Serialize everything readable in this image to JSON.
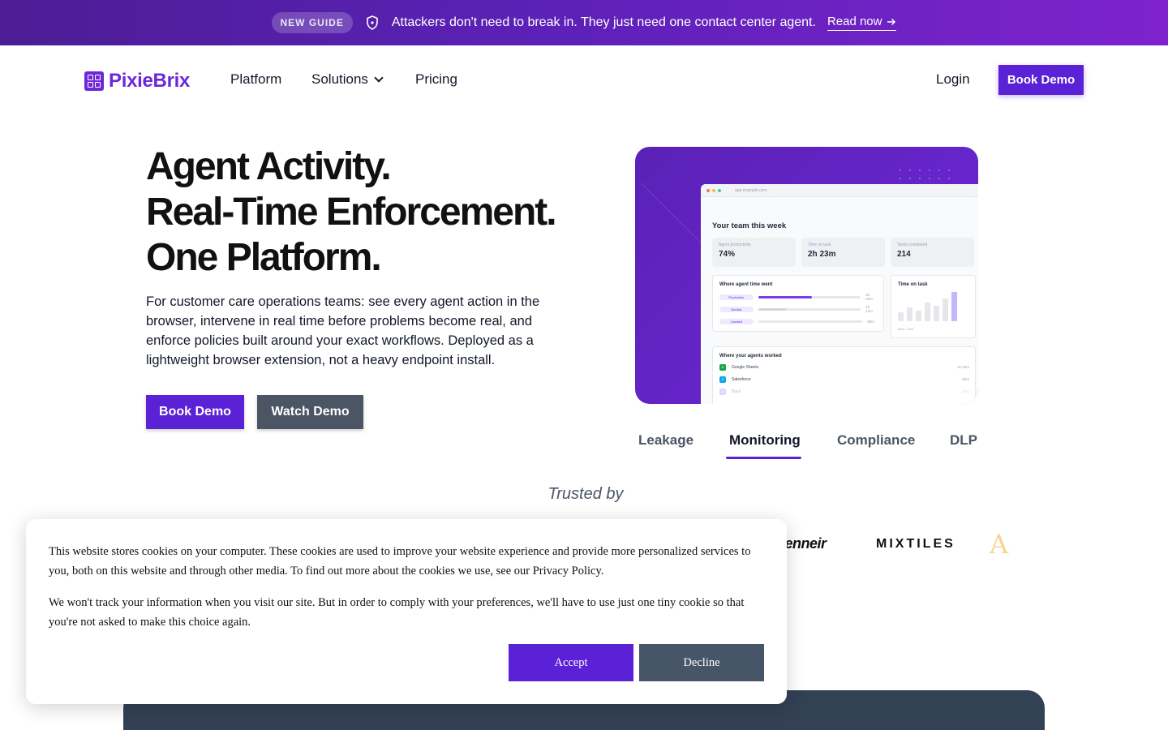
{
  "announcement": {
    "badge": "NEW GUIDE",
    "message": "Attackers don't need to break in. They just need one contact center agent.",
    "link": "Read now"
  },
  "nav": {
    "brand": "PixieBrix",
    "links": [
      "Platform",
      "Solutions",
      "Pricing"
    ],
    "login": "Login",
    "book_demo": "Book Demo"
  },
  "hero": {
    "title_lines": [
      "Agent Activity.",
      "Real-Time Enforcement.",
      "One Platform."
    ],
    "description": "For customer care operations teams: see every agent action in the browser, intervene in real time before problems become real, and enforce policies built around your exact workflows. Deployed as a lightweight browser extension, not a heavy endpoint install.",
    "book_demo": "Book Demo",
    "watch_demo": "Watch Demo"
  },
  "preview": {
    "url": "app.example.com",
    "heading": "Your team this week",
    "stats": [
      {
        "label": "Agent productivity",
        "value": "74%"
      },
      {
        "label": "Time on task",
        "value": "2h 23m"
      },
      {
        "label": "Tasks completed",
        "value": "214"
      }
    ],
    "time_panel": {
      "title": "Where agent time went",
      "rows": [
        {
          "label": "Productive",
          "time": "3h 05m",
          "fraction": 0.52,
          "color": "#7c3aed"
        },
        {
          "label": "Neutral",
          "time": "1h 12m",
          "fraction": 0.27,
          "color": "#d1d5db"
        },
        {
          "label": "Unrated",
          "time": "38m",
          "fraction": 0.15,
          "color": "#e5e7eb"
        }
      ]
    },
    "task_panel": {
      "title": "Time on task",
      "range": "Mon – Sun",
      "bars": [
        0.3,
        0.45,
        0.35,
        0.6,
        0.5,
        0.75,
        0.95
      ]
    },
    "sites_panel": {
      "title": "Where your agents worked",
      "rows": [
        {
          "icon": "G",
          "name": "Google Sheets",
          "time": "1h 42m",
          "color": "#16a34a"
        },
        {
          "icon": "S",
          "name": "Salesforce",
          "time": "58m",
          "color": "#0ea5e9"
        },
        {
          "icon": "B",
          "name": "Back",
          "time": "23m",
          "color": "#a78bfa"
        }
      ]
    }
  },
  "tabs": [
    "Leakage",
    "Monitoring",
    "Compliance",
    "DLP"
  ],
  "active_tab": "Monitoring",
  "trusted_by": "Trusted by",
  "customer_logos": [
    "fenneir",
    "MIXTILES",
    "A"
  ],
  "cookie": {
    "p1": "This website stores cookies on your computer. These cookies are used to improve your website experience and provide more personalized services to you, both on this website and through other media. To find out more about the cookies we use, see our Privacy Policy.",
    "p2": "We won't track your information when you visit our site. But in order to comply with your preferences, we'll have to use just one tiny cookie so that you're not asked to make this choice again.",
    "accept": "Accept",
    "decline": "Decline"
  },
  "colors": {
    "brand": "#5b21d6",
    "secondary_button": "#4b5563",
    "banner_start": "#4c1d95",
    "banner_end": "#7e22ce"
  },
  "icons": [
    "shield-icon",
    "arrow-right-icon",
    "chevron-down-icon",
    "pixiebrix-logo-icon"
  ]
}
